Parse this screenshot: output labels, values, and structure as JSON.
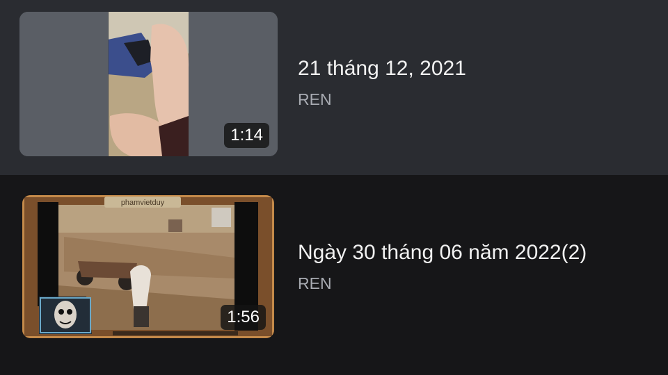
{
  "videos": [
    {
      "title": "21 tháng 12, 2021",
      "channel": "REN",
      "duration": "1:14"
    },
    {
      "title": "Ngày 30 tháng 06 năm 2022(2)",
      "channel": "REN",
      "duration": "1:56",
      "thumbnail_text": "phamvietduy"
    }
  ]
}
